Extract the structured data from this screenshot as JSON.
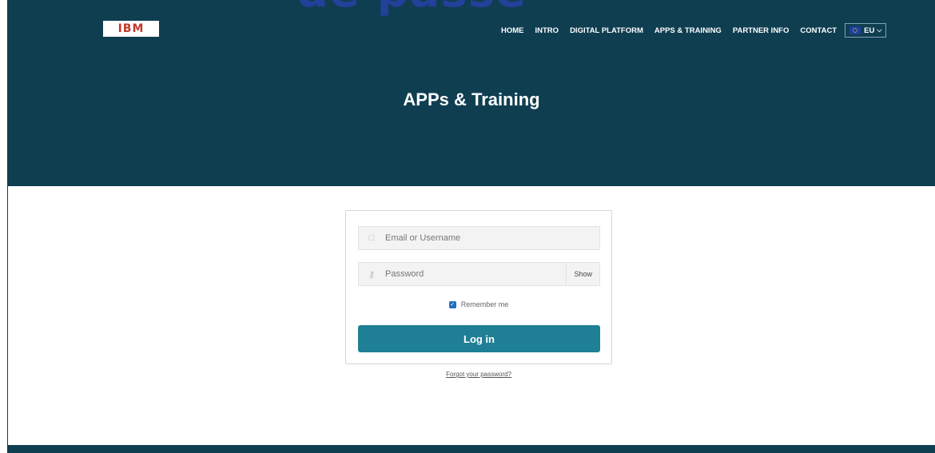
{
  "overlay_text": "de passe",
  "logo": {
    "text": "IBM"
  },
  "nav": [
    {
      "label": "HOME"
    },
    {
      "label": "INTRO"
    },
    {
      "label": "DIGITAL PLATFORM"
    },
    {
      "label": "APPS & TRAINING"
    },
    {
      "label": "PARTNER INFO"
    },
    {
      "label": "CONTACT"
    }
  ],
  "language": {
    "label": "EU",
    "icon": "eu-flag-icon"
  },
  "page_title": "APPs & Training",
  "login": {
    "username_placeholder": "Email or Username",
    "password_placeholder": "Password",
    "show_label": "Show",
    "remember_label": "Remember me",
    "remember_checked": true,
    "login_label": "Log in",
    "forgot_label": "Forgot your password?"
  },
  "colors": {
    "header_bg": "#0f3e51",
    "button_bg": "#1f7f95",
    "overlay_text": "#23409a"
  }
}
